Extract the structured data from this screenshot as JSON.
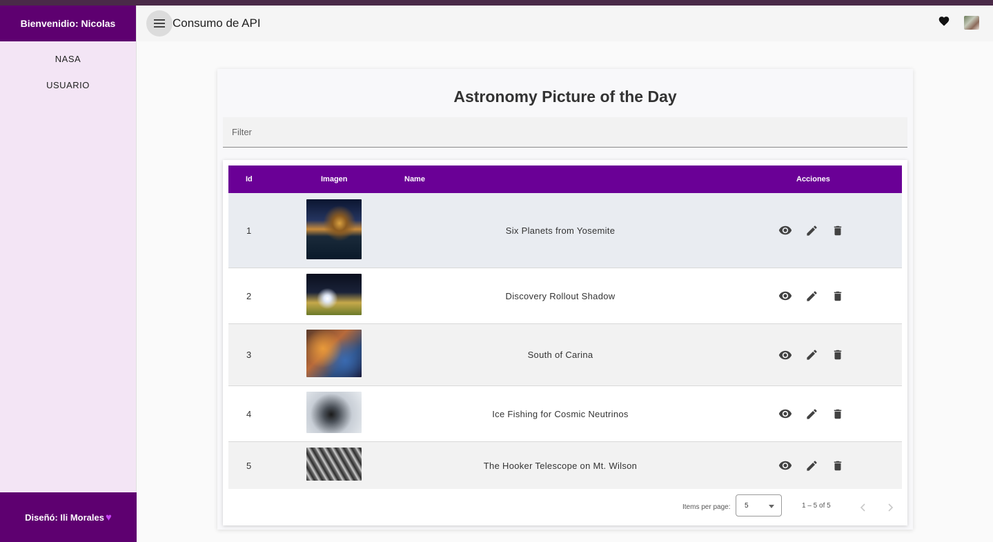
{
  "sidebar": {
    "header": "Bienvenidio: Nicolas",
    "items": [
      {
        "label": "NASA"
      },
      {
        "label": "USUARIO"
      }
    ],
    "footer": "Diseñó: Ili Morales",
    "footer_icon": "purple-heart-icon"
  },
  "toolbar": {
    "title": "Consumo de API",
    "menu_icon": "menu-icon",
    "favorite_icon": "heart-icon"
  },
  "page": {
    "title": "Astronomy Picture of the Day",
    "filter_placeholder": "Filter"
  },
  "table": {
    "headers": {
      "id": "Id",
      "image": "Imagen",
      "name": "Name",
      "actions": "Acciones"
    },
    "rows": [
      {
        "id": "1",
        "name": "Six Planets from Yosemite"
      },
      {
        "id": "2",
        "name": "Discovery Rollout Shadow"
      },
      {
        "id": "3",
        "name": "South of Carina"
      },
      {
        "id": "4",
        "name": "Ice Fishing for Cosmic Neutrinos"
      },
      {
        "id": "5",
        "name": "The Hooker Telescope on Mt. Wilson"
      }
    ],
    "action_icons": [
      "eye-icon",
      "pencil-icon",
      "trash-icon"
    ]
  },
  "paginator": {
    "items_per_page_label": "Items per page:",
    "items_per_page_value": "5",
    "range_label": "1 – 5 of 5"
  },
  "colors": {
    "sidebar_header": "#5e0070",
    "table_header": "#6a0096",
    "sidebar_bg": "#f3e5f5"
  }
}
